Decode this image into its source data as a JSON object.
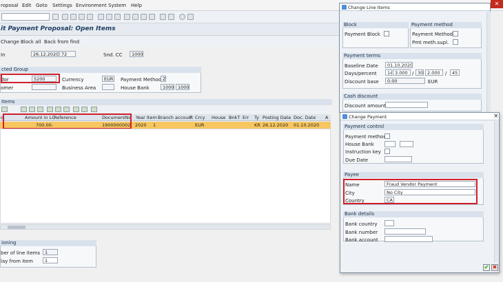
{
  "menu": [
    "roposal",
    "Edit",
    "Goto",
    "Settings",
    "Environment",
    "System",
    "Help"
  ],
  "title": "it Payment Proposal: Open Items",
  "app_toolbar": [
    "Change",
    "Block all",
    "Back from find"
  ],
  "header_fields": {
    "date_label": "In",
    "date_value": "26.12.2020",
    "id_value": "72",
    "snd_cc_label": "Snd. CC",
    "snd_cc_value": "1000"
  },
  "selected_group": {
    "title": "cted Group",
    "vendor_label": "dor",
    "vendor_value": "5200",
    "customer_label": "omer",
    "currency_label": "Currency",
    "currency_value": "EUR",
    "business_area_label": "Business Area",
    "payment_method_label": "Payment Method",
    "payment_method_value": "Z",
    "house_bank_label": "House Bank",
    "house_bank_value1": "1000",
    "house_bank_value2": "1000"
  },
  "items": {
    "title": "Items",
    "columns": [
      "d",
      "Amount in LC",
      "Reference",
      "DocumentNo",
      "Year",
      "Item",
      "Branch account",
      "P",
      "Crcy",
      "House",
      "BnkT",
      "Err",
      "Ty",
      "Posting Date",
      "Doc. Date",
      "A"
    ],
    "row": {
      "amount": "700.00-",
      "document_no": "1900000002",
      "year": "2020",
      "item": "1",
      "crcy": "EUR",
      "ty": "KR",
      "posting_date": "26.12.2020",
      "doc_date": "01.10.2020"
    }
  },
  "positioning": {
    "title": "ioning",
    "num_items_label": "ber of line items",
    "num_items_value": "1",
    "display_from_label": "lay from item",
    "display_from_value": "1"
  },
  "change_line_items": {
    "title": "Change Line Items",
    "block_hdr": "Block",
    "payment_block_label": "Payment Block",
    "payment_method_hdr": "Payment method",
    "payment_method_label": "Payment Method",
    "pmt_meth_supl_label": "Pmt meth.supl.",
    "payment_terms_hdr": "Payment terms",
    "baseline_date_label": "Baseline Date",
    "baseline_date_value": "01.10.2020",
    "days_percent_label": "Days/percent",
    "days1": "14",
    "pct1": "3.000",
    "sep1": "/",
    "days2": "30",
    "pct2": "2.000",
    "sep2": "/",
    "days3": "45",
    "discount_base_label": "Discount base",
    "discount_base_value": "0.00",
    "discount_base_currency": "EUR",
    "cash_discount_hdr": "Cash discount",
    "discount_amount_label": "Discount amount"
  },
  "change_payment": {
    "title": "Change Payment",
    "close_icon": "×",
    "payment_control_hdr": "Payment control",
    "payment_method_label": "Payment method",
    "house_bank_label": "House Bank",
    "instruction_key_label": "Instruction key",
    "due_date_label": "Due Date",
    "payee_hdr": "Payee",
    "name_label": "Name",
    "name_value": "Fraud Vendor Payment",
    "city_label": "City",
    "city_value": "No City",
    "country_label": "Country",
    "country_value": "CA",
    "bank_details_hdr": "Bank details",
    "bank_country_label": "Bank country",
    "bank_number_label": "Bank number",
    "bank_account_label": "Bank account",
    "ok_icon": "✔",
    "cancel_icon": "✖"
  },
  "window_close": "✕",
  "colors": {
    "highlight": "#d01e2a",
    "selected_row": "#f7c660",
    "title": "#1f3d63"
  }
}
